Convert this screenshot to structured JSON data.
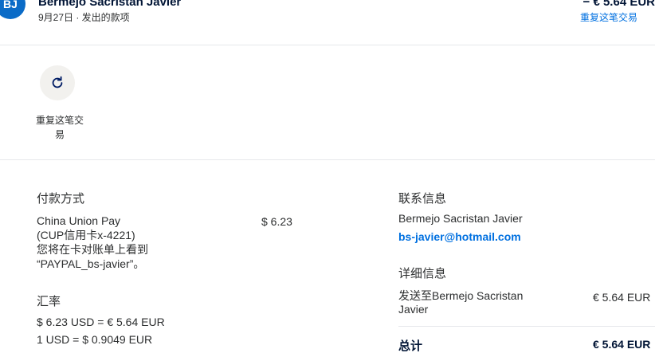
{
  "header": {
    "avatar_initials": "BJ",
    "name": "Bermejo Sacristan Javier",
    "date_type": "9月27日 · 发出的款项",
    "amount": "− € 5.64 EUR",
    "repeat_link": "重复这笔交易"
  },
  "actions": {
    "repeat_icon": "refresh-icon",
    "repeat_label": "重复这笔交易"
  },
  "payment": {
    "title": "付款方式",
    "method_lines": [
      "China Union Pay",
      "(CUP信用卡x-4221)",
      "您将在卡对账单上看到",
      "“PAYPAL_bs-javier”。"
    ],
    "amount": "$ 6.23"
  },
  "exchange": {
    "title": "汇率",
    "line1": "$ 6.23 USD = € 5.64 EUR",
    "line2": "1 USD = $ 0.9049 EUR"
  },
  "contact": {
    "title": "联系信息",
    "name": "Bermejo Sacristan Javier",
    "email": "bs-javier@hotmail.com"
  },
  "details": {
    "title": "详细信息",
    "ship_to_line1": "发送至Bermejo Sacristan",
    "ship_to_line2": "Javier",
    "ship_amount": "€ 5.64 EUR",
    "total_label": "总计",
    "total_amount": "€ 5.64 EUR"
  },
  "colors": {
    "avatar_bg": "#0a6bc7",
    "link": "#0070e0",
    "text_dark": "#001435",
    "circle_bg": "#f2f1ee"
  }
}
